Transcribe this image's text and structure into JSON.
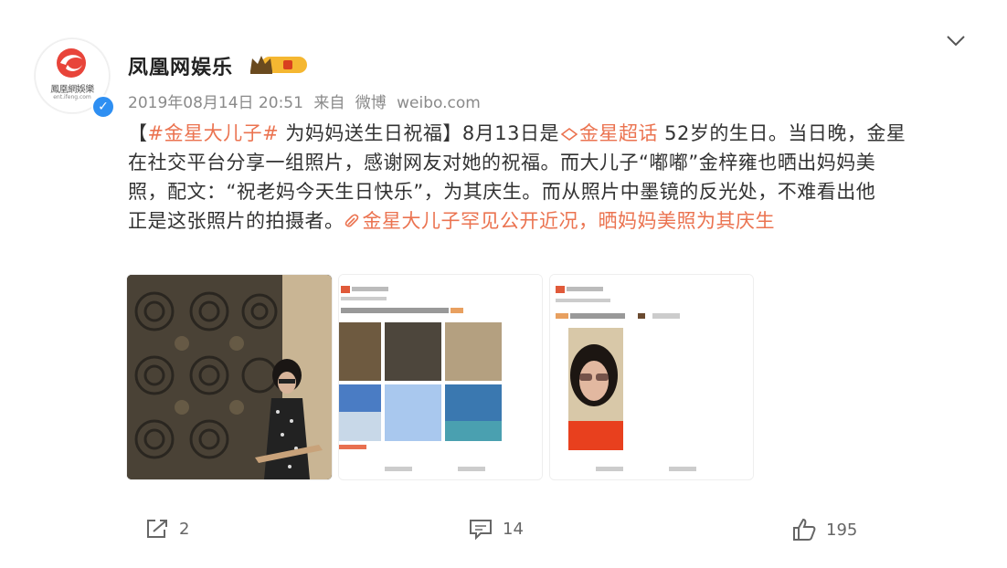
{
  "account": {
    "name": "凤凰网娱乐",
    "avatar_text": "鳳凰網娛樂",
    "avatar_sub": "ent.ifeng.com",
    "verified_icon": "verified-badge",
    "crown_icon": "crown-icon"
  },
  "post": {
    "timestamp": "2019年08月14日 20:51",
    "source_prefix": "来自",
    "source_name": "微博",
    "source_domain": "weibo.com",
    "text": {
      "l1a": "【",
      "l1_tag": "#金星大儿子#",
      "l1b": " 为妈妈送生日祝福】8月13日是",
      "l1_topic": "金星超话",
      "l1c": " 52岁的生日。当日晚，金星",
      "l2": "在社交平台分享一组照片，感谢网友对她的祝福。而大儿子“嘟嘟”金梓雍也晒出妈妈美",
      "l3": "照，配文：“祝老妈今天生日快乐”，为其庆生。而从照片中墨镜的反光处，不难看出他",
      "l4a": "正是这张照片的拍摄者。",
      "l4_link": "金星大儿子罕见公开近况，晒妈妈美照为其庆生"
    }
  },
  "actions": {
    "repost_count": "2",
    "comment_count": "14",
    "like_count": "195"
  },
  "colors": {
    "link": "#eb7350",
    "verified": "#2e8ff2",
    "brand_red": "#e8443a"
  }
}
